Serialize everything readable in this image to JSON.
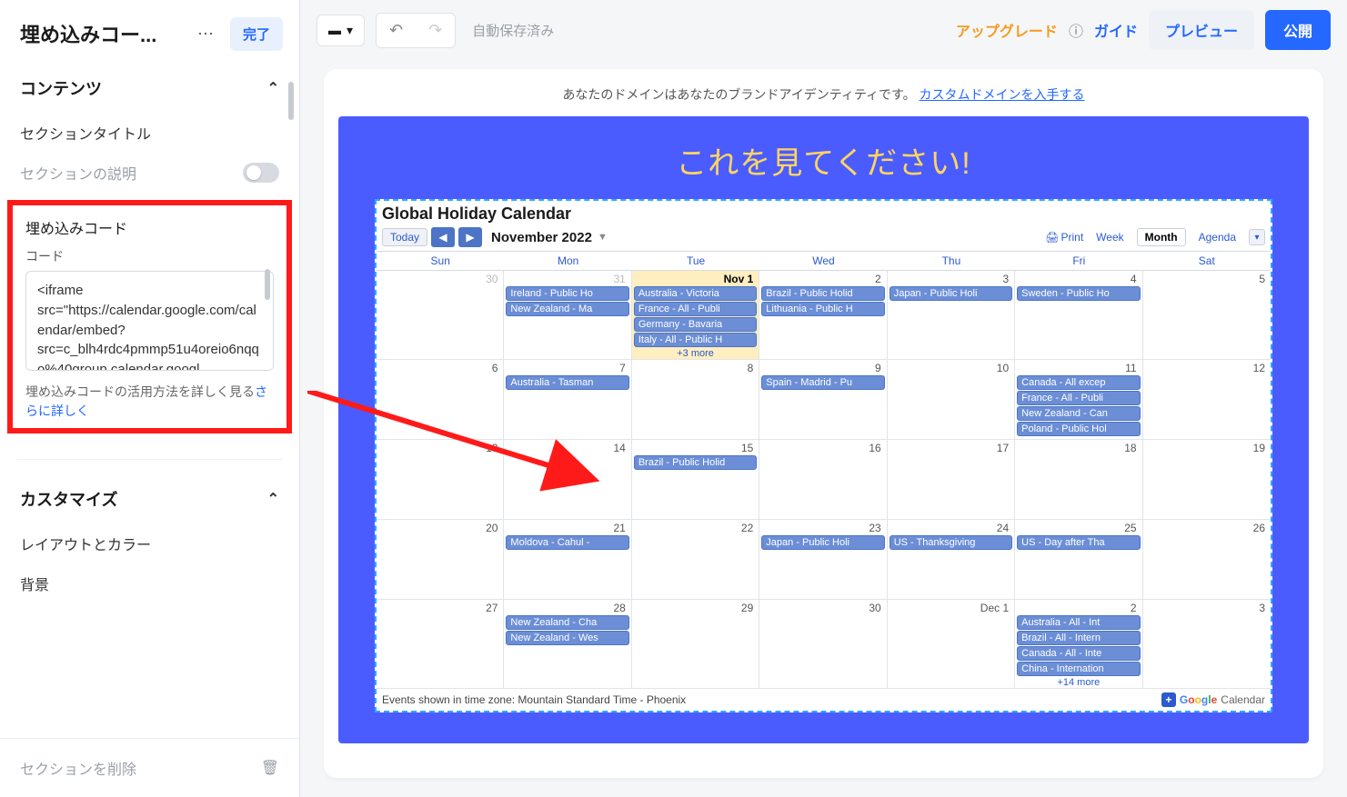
{
  "sidebar": {
    "title": "埋め込みコー...",
    "done": "完了",
    "contentsHead": "コンテンツ",
    "sectionTitle": "セクションタイトル",
    "sectionDesc": "セクションの説明",
    "embedHead": "埋め込みコード",
    "codeLabel": "コード",
    "codeValue": "<iframe src=\"https://calendar.google.com/calendar/embed?src=c_blh4rdc4pmmp51u4oreio6nqqo%40group.calendar.googl",
    "helpPrefix": "埋め込みコードの活用方法を詳しく見る",
    "helpLink": "さらに詳しく",
    "customizeHead": "カスタマイズ",
    "layout": "レイアウトとカラー",
    "background": "背景",
    "delete": "セクションを削除"
  },
  "topbar": {
    "autosave": "自動保存済み",
    "upgrade": "アップグレード",
    "guide": "ガイド",
    "preview": "プレビュー",
    "publish": "公開"
  },
  "banner": {
    "text": "あなたのドメインはあなたのブランドアイデンティティです。 ",
    "link": "カスタムドメインを入手する"
  },
  "page": {
    "heading": "これを見てください!"
  },
  "calendar": {
    "title": "Global Holiday Calendar",
    "today": "Today",
    "month": "November 2022",
    "print": "Print",
    "tabs": {
      "week": "Week",
      "month": "Month",
      "agenda": "Agenda"
    },
    "dows": [
      "Sun",
      "Mon",
      "Tue",
      "Wed",
      "Thu",
      "Fri",
      "Sat"
    ],
    "tz": "Events shown in time zone: Mountain Standard Time - Phoenix",
    "brand": "Calendar",
    "rows": [
      [
        {
          "n": "30",
          "gray": true
        },
        {
          "n": "31",
          "gray": true,
          "ev": [
            "Ireland - Public Ho",
            "New Zealand - Ma"
          ]
        },
        {
          "n": "Nov 1",
          "today": true,
          "ev": [
            "Australia - Victoria",
            "France - All - Publi",
            "Germany - Bavaria",
            "Italy - All - Public H"
          ],
          "more": "+3 more"
        },
        {
          "n": "2",
          "ev": [
            "Brazil - Public Holid",
            "Lithuania - Public H"
          ]
        },
        {
          "n": "3",
          "ev": [
            "Japan - Public Holi"
          ]
        },
        {
          "n": "4",
          "ev": [
            "Sweden - Public Ho"
          ]
        },
        {
          "n": "5"
        }
      ],
      [
        {
          "n": "6"
        },
        {
          "n": "7",
          "ev": [
            "Australia - Tasman"
          ]
        },
        {
          "n": "8"
        },
        {
          "n": "9",
          "ev": [
            "Spain - Madrid - Pu"
          ]
        },
        {
          "n": "10"
        },
        {
          "n": "11",
          "ev": [
            "Canada - All excep",
            "France - All - Publi",
            "New Zealand - Can",
            "Poland - Public Hol"
          ]
        },
        {
          "n": "12"
        }
      ],
      [
        {
          "n": "13"
        },
        {
          "n": "14"
        },
        {
          "n": "15",
          "ev": [
            "Brazil - Public Holid"
          ]
        },
        {
          "n": "16"
        },
        {
          "n": "17"
        },
        {
          "n": "18"
        },
        {
          "n": "19"
        }
      ],
      [
        {
          "n": "20"
        },
        {
          "n": "21",
          "ev": [
            "Moldova - Cahul - "
          ]
        },
        {
          "n": "22"
        },
        {
          "n": "23",
          "ev": [
            "Japan - Public Holi"
          ]
        },
        {
          "n": "24",
          "ev": [
            "US - Thanksgiving"
          ]
        },
        {
          "n": "25",
          "ev": [
            "US - Day after Tha"
          ]
        },
        {
          "n": "26"
        }
      ],
      [
        {
          "n": "27"
        },
        {
          "n": "28",
          "ev": [
            "New Zealand - Cha",
            "New Zealand - Wes"
          ]
        },
        {
          "n": "29"
        },
        {
          "n": "30"
        },
        {
          "n": "Dec 1"
        },
        {
          "n": "2",
          "ev": [
            "Australia - All - Int",
            "Brazil - All - Intern",
            "Canada - All - Inte",
            "China - Internation"
          ],
          "more": "+14 more"
        },
        {
          "n": "3"
        }
      ]
    ]
  }
}
